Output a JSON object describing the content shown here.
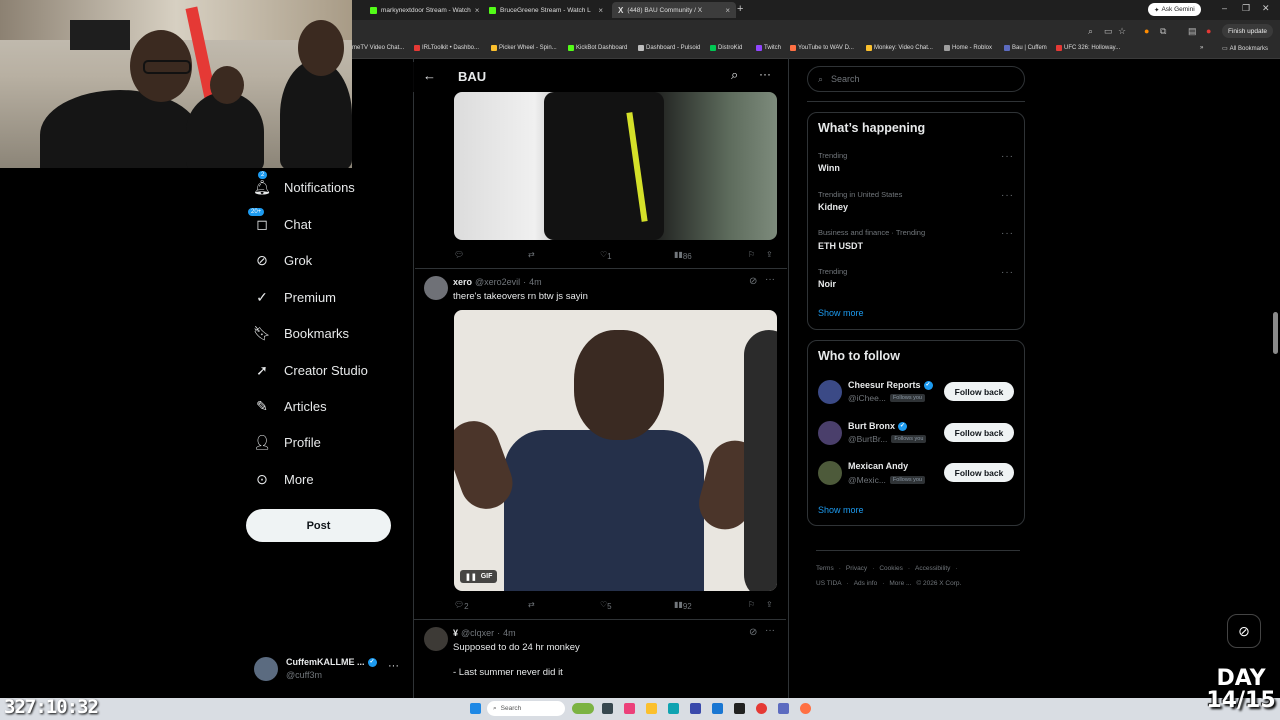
{
  "browser": {
    "tabs": [
      {
        "label": "markynextdoor Stream - Watch",
        "color": "#53fc18",
        "active": false
      },
      {
        "label": "BruceGreene Stream - Watch L",
        "color": "#53fc18",
        "active": false
      },
      {
        "label": "(448) BAU Community / X",
        "color": "#ffffff",
        "active": true
      }
    ],
    "new_tab": "+",
    "ask_gemini": "Ask Gemini",
    "finish_update": "Finish update",
    "bookmarks": [
      {
        "label": "meTV Video Chat...",
        "color": "#8ab4f8"
      },
      {
        "label": "IRLToolkit • Dashbo...",
        "color": "#e53935"
      },
      {
        "label": "Picker Wheel - Spin...",
        "color": "#fbc02d"
      },
      {
        "label": "KickBot Dashboard",
        "color": "#53fc18"
      },
      {
        "label": "Dashboard - Pulsoid",
        "color": "#bdbdbd"
      },
      {
        "label": "DistroKid",
        "color": "#00c853"
      },
      {
        "label": "Twitch",
        "color": "#9146ff"
      },
      {
        "label": "YouTube to WAV D...",
        "color": "#ff7043"
      },
      {
        "label": "Monkey: Video Chat...",
        "color": "#fbc02d"
      },
      {
        "label": "Home - Roblox",
        "color": "#9e9e9e"
      },
      {
        "label": "Bau | Cuffem",
        "color": "#5c6bc0"
      },
      {
        "label": "UFC 326: Holloway...",
        "color": "#e53935"
      }
    ],
    "all_bookmarks": "All Bookmarks"
  },
  "nav": {
    "items": [
      {
        "label": "Notifications",
        "icon": "bell-icon",
        "badge": "2"
      },
      {
        "label": "Chat",
        "icon": "chat-icon",
        "badge": "20+"
      },
      {
        "label": "Grok",
        "icon": "grok-icon"
      },
      {
        "label": "Premium",
        "icon": "premium-icon"
      },
      {
        "label": "Bookmarks",
        "icon": "bookmark-icon"
      },
      {
        "label": "Creator Studio",
        "icon": "rocket-icon"
      },
      {
        "label": "Articles",
        "icon": "article-icon"
      },
      {
        "label": "Profile",
        "icon": "person-icon"
      },
      {
        "label": "More",
        "icon": "more-circle-icon"
      }
    ],
    "post_label": "Post",
    "account": {
      "name": "CuffemKALLME ...",
      "handle": "@cuff3m"
    }
  },
  "feed": {
    "title": "BAU",
    "top_tweet_actions": {
      "replies": "",
      "likes": "1",
      "views": "86"
    },
    "tweets": [
      {
        "name": "xero",
        "handle": "@xero2evil",
        "time": "4m",
        "text": "there's takeovers rn btw js sayin",
        "gif_label": "GIF",
        "replies": "2",
        "likes": "5",
        "views": "92"
      },
      {
        "name": "¥",
        "handle": "@clqxer",
        "time": "4m",
        "lines": [
          "Supposed to do 24 hr monkey",
          "- Last summer never did it"
        ]
      }
    ]
  },
  "sidebar": {
    "search_placeholder": "Search",
    "whats_happening_title": "What’s happening",
    "trends": [
      {
        "context": "Trending",
        "name": "Winn"
      },
      {
        "context": "Trending in United States",
        "name": "Kidney"
      },
      {
        "context": "Business and finance · Trending",
        "name": "ETH USDT"
      },
      {
        "context": "Trending",
        "name": "Noir"
      }
    ],
    "show_more": "Show more",
    "who_to_follow_title": "Who to follow",
    "follow_suggestions": [
      {
        "name": "Cheesur Reports",
        "handle": "@iChee...",
        "verified": true,
        "follows_you": "Follows you",
        "button": "Follow back"
      },
      {
        "name": "Burt Bronx",
        "handle": "@BurtBr...",
        "verified": true,
        "follows_you": "Follows you",
        "button": "Follow back"
      },
      {
        "name": "Mexican Andy",
        "handle": "@Mexic...",
        "verified": false,
        "follows_you": "Follows you",
        "button": "Follow back"
      }
    ],
    "footer_row1": [
      "Terms",
      "Privacy",
      "Cookies",
      "Accessibility"
    ],
    "footer_row2": [
      "US TIDA",
      "Ads info",
      "More ...",
      "© 2026 X Corp."
    ]
  },
  "overlay": {
    "timer": "327:10:32",
    "day_label": "DAY",
    "day_count": "14/15"
  },
  "taskbar": {
    "search_label": "Search"
  },
  "colors": {
    "accent": "#1d9bf0",
    "background": "#000000",
    "border": "#2f3336",
    "muted_text": "#71767b"
  }
}
